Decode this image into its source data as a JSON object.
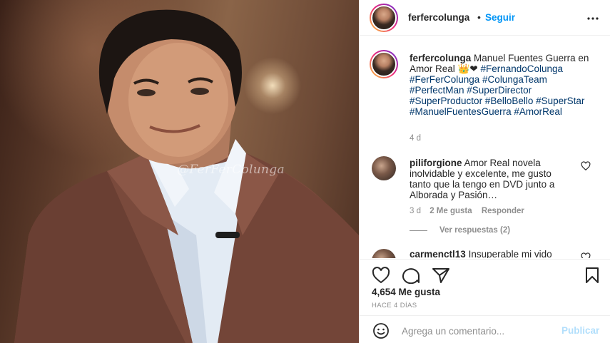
{
  "post": {
    "username": "ferfercolunga",
    "follow_label": "Seguir",
    "separator": "•",
    "watermark": "@FerFerColunga"
  },
  "caption": {
    "username": "ferfercolunga",
    "text": "Manuel Fuentes Guerra en Amor Real",
    "emoji": "👑❤",
    "hashtags": "#FernandoColunga #FerFerColunga #ColungaTeam #PerfectMan #SuperDirector #SuperProductor #BelloBello #SuperStar #ManuelFuentesGuerra #AmorReal",
    "age": "4 d"
  },
  "comments": [
    {
      "username": "piliforgione",
      "text": "Amor Real novela inolvidable y excelente, me gusto tanto que la tengo en DVD junto a Alborada y Pasión…",
      "age": "3 d",
      "likes": "2 Me gusta",
      "reply": "Responder",
      "view_replies": "Ver respuestas (2)"
    },
    {
      "username": "carmenctl13",
      "text": "Insuperable mi vido"
    }
  ],
  "actions": {
    "likes": "4,654 Me gusta",
    "posted_ago": "HACE 4 DÍAS",
    "comment_placeholder": "Agrega un comentario...",
    "publish_label": "Publicar"
  },
  "icons": [
    "more-icon",
    "heart-icon",
    "comment-icon",
    "share-icon",
    "bookmark-icon",
    "emoji-icon"
  ],
  "colors": {
    "link_blue": "#0095f6",
    "hashtag": "#00376b",
    "publish_disabled": "#b2dffc",
    "muted": "#8e8e8e"
  }
}
